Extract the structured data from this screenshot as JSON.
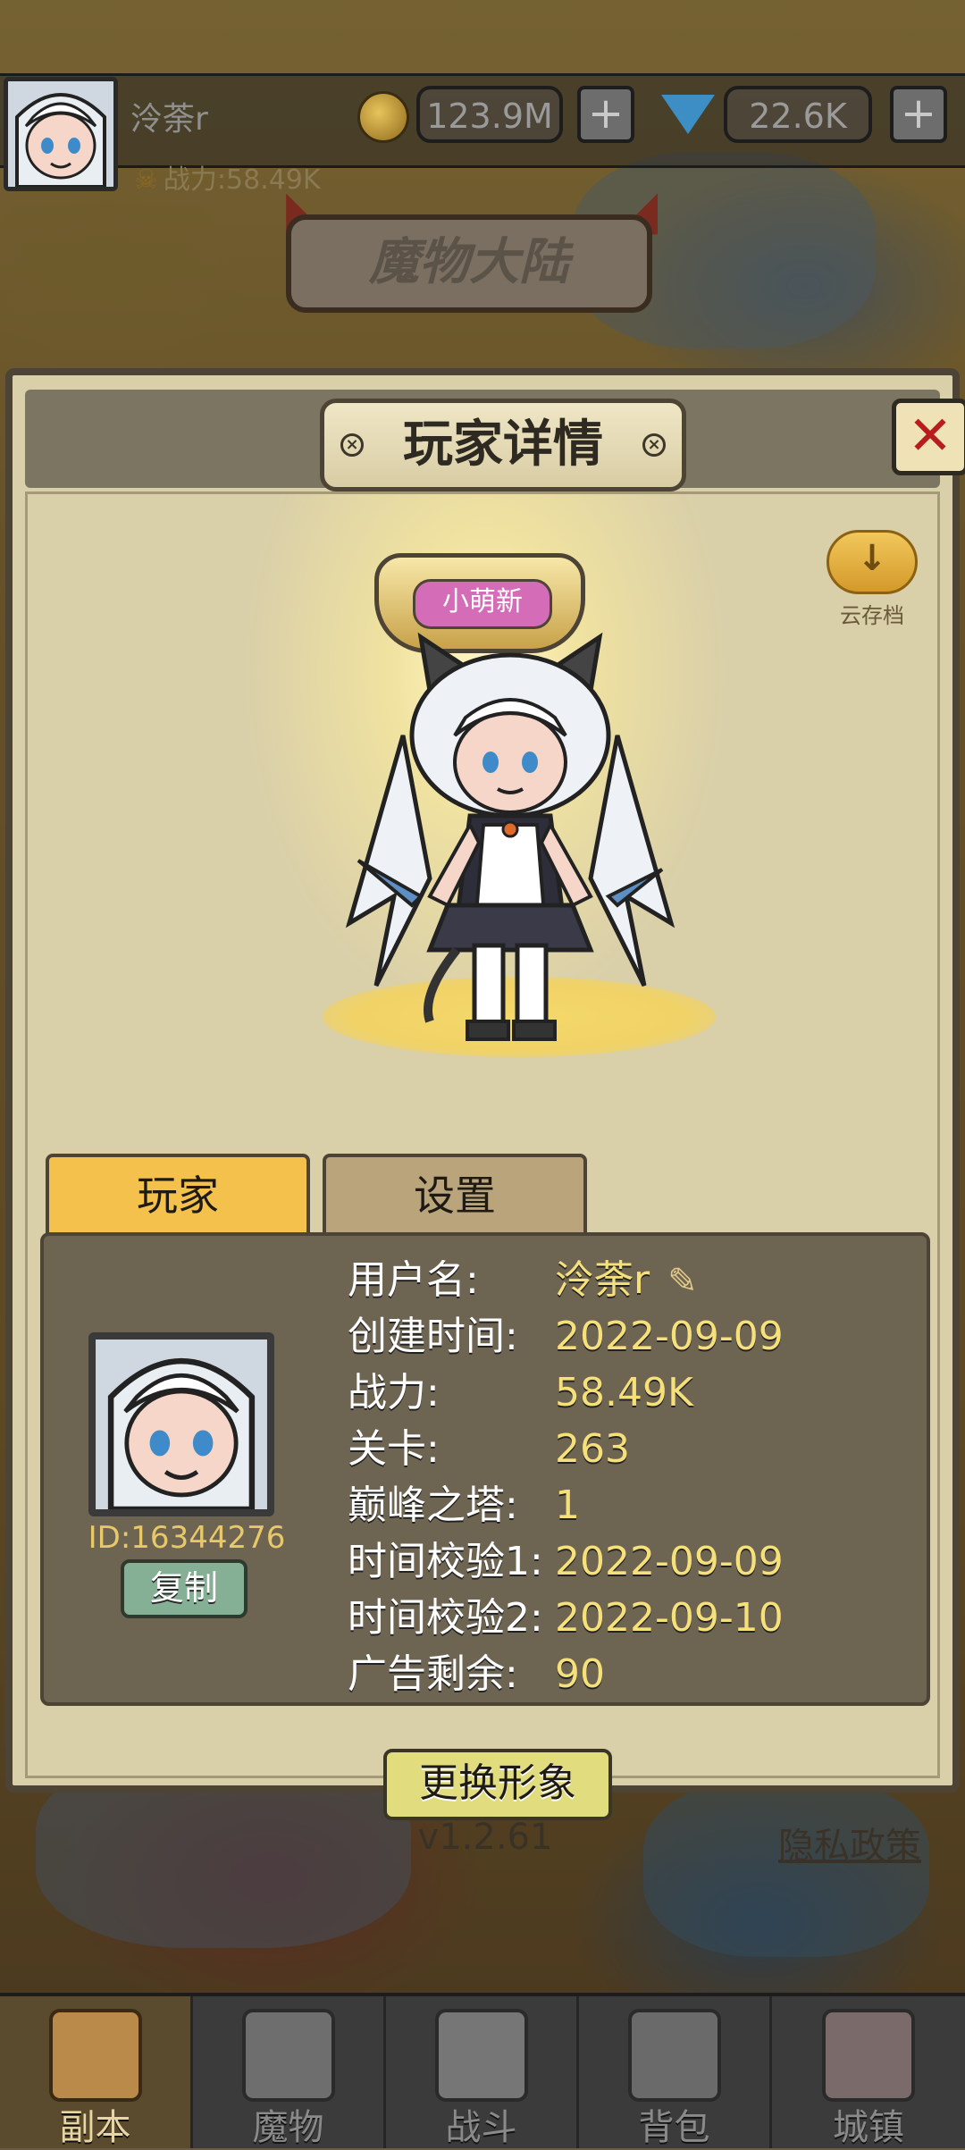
{
  "hud": {
    "player_name": "泠荼r",
    "gold": "123.9M",
    "gems": "22.6K",
    "power": "战力:58.49K",
    "region": "魔物大陆",
    "gold_plus": "+",
    "gem_plus": "+"
  },
  "dialog": {
    "title": "玩家详情",
    "close_label": "✕",
    "cloud_save_label": "云存档",
    "rank_label": "小萌新",
    "tabs": [
      {
        "label": "玩家"
      },
      {
        "label": "设置"
      }
    ],
    "player_id": "ID:16344276",
    "copy_label": "复制",
    "info": [
      {
        "label": "用户名:",
        "value": "泠荼r"
      },
      {
        "label": "创建时间:",
        "value": "2022-09-09"
      },
      {
        "label": "战力:",
        "value": "58.49K"
      },
      {
        "label": "关卡:",
        "value": "263"
      },
      {
        "label": "巅峰之塔:",
        "value": "1"
      },
      {
        "label": "时间校验1:",
        "value": "2022-09-09"
      },
      {
        "label": "时间校验2:",
        "value": "2022-09-10"
      },
      {
        "label": "广告剩余:",
        "value": "90"
      }
    ],
    "change_avatar_label": "更换形象",
    "version": "v1.2.61",
    "privacy_label": "隐私政策"
  },
  "bottom_nav": [
    {
      "label": "副本",
      "icon": "map-scroll-icon"
    },
    {
      "label": "魔物",
      "icon": "monster-helmet-icon"
    },
    {
      "label": "战斗",
      "icon": "crossed-swords-icon"
    },
    {
      "label": "背包",
      "icon": "backpack-icon"
    },
    {
      "label": "城镇",
      "icon": "shop-building-icon"
    }
  ],
  "colors": {
    "accent_gold": "#f4c14c",
    "value_yellow": "#f5e07a",
    "close_red": "#b81d1d",
    "rank_pink": "#d46cb7"
  }
}
